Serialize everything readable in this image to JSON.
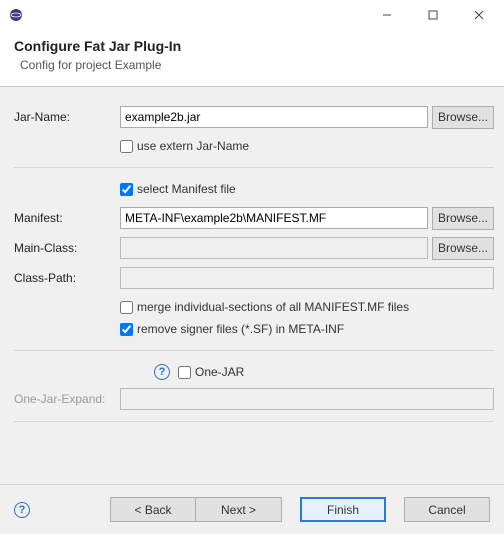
{
  "titlebar": {
    "icon": "eclipse-icon"
  },
  "header": {
    "title": "Configure Fat Jar Plug-In",
    "subtitle": "Config for project Example"
  },
  "labels": {
    "jar_name": "Jar-Name:",
    "manifest": "Manifest:",
    "main_class": "Main-Class:",
    "class_path": "Class-Path:",
    "one_jar_expand": "One-Jar-Expand:"
  },
  "fields": {
    "jar_name": "example2b.jar",
    "manifest": "META-INF\\example2b\\MANIFEST.MF",
    "main_class": "",
    "class_path": "",
    "one_jar_expand": ""
  },
  "checkboxes": {
    "use_extern": {
      "label": "use extern Jar-Name",
      "checked": false
    },
    "select_manifest": {
      "label": "select Manifest file",
      "checked": true
    },
    "merge": {
      "label": "merge individual-sections of all MANIFEST.MF files",
      "checked": false
    },
    "remove_signer": {
      "label": "remove signer files (*.SF) in META-INF",
      "checked": true
    },
    "one_jar": {
      "label": "One-JAR",
      "checked": false
    }
  },
  "buttons": {
    "browse": "Browse...",
    "back": "< Back",
    "next": "Next >",
    "finish": "Finish",
    "cancel": "Cancel"
  }
}
